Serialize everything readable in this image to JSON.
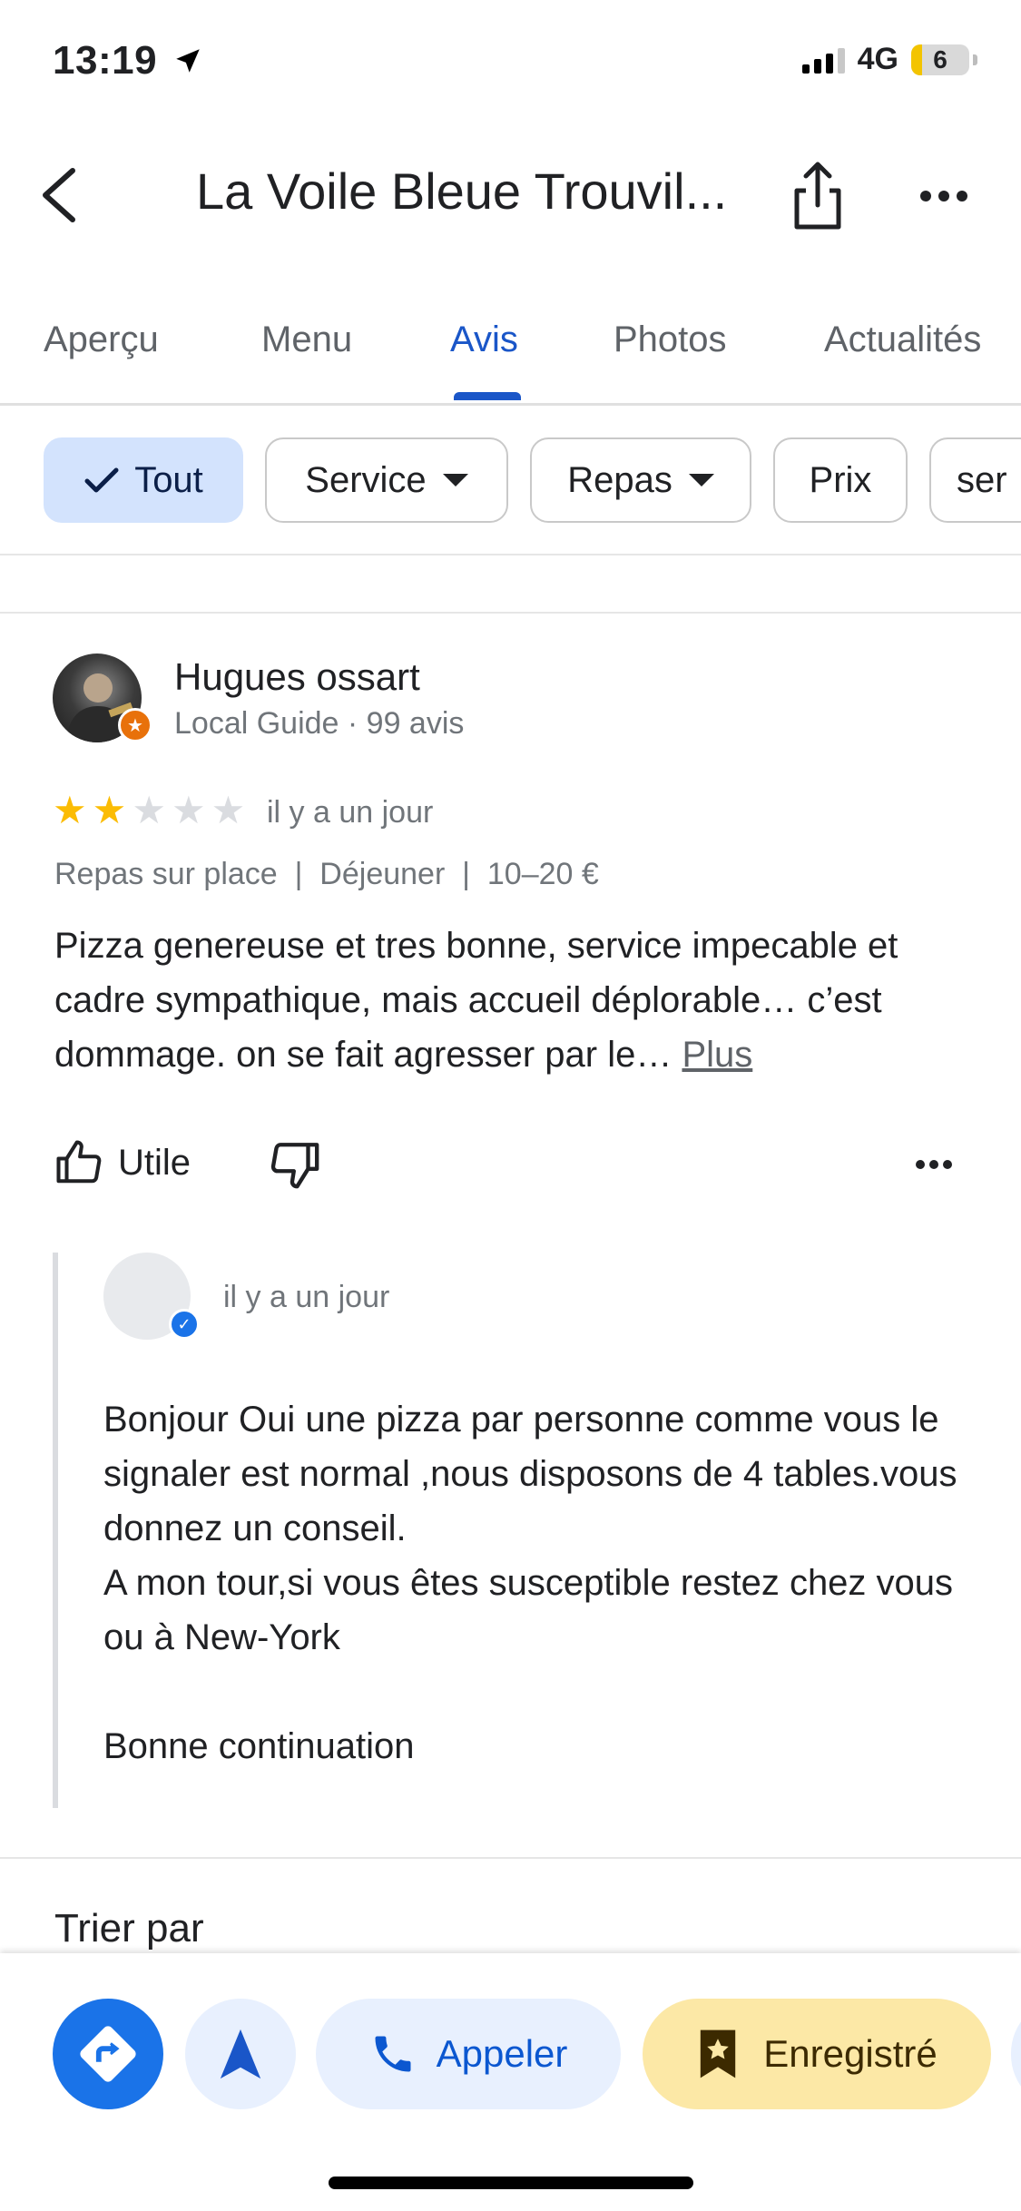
{
  "status_bar": {
    "time": "13:19",
    "network": "4G",
    "battery": "6"
  },
  "header": {
    "title": "La Voile Bleue Trouvil..."
  },
  "tabs": [
    {
      "label": "Aperçu",
      "active": false
    },
    {
      "label": "Menu",
      "active": false
    },
    {
      "label": "Avis",
      "active": true
    },
    {
      "label": "Photos",
      "active": false
    },
    {
      "label": "Actualités",
      "active": false
    }
  ],
  "filters": [
    {
      "label": "Tout",
      "selected": true
    },
    {
      "label": "Service",
      "dropdown": true
    },
    {
      "label": "Repas",
      "dropdown": true
    },
    {
      "label": "Prix"
    },
    {
      "label": "ser"
    }
  ],
  "review": {
    "author": "Hugues ossart",
    "meta": "Local Guide · 99 avis",
    "rating": 2,
    "rating_max": 5,
    "date": "il y a un jour",
    "visit_meta": "Repas sur place  |  Déjeuner  |  10–20 €",
    "text": "Pizza genereuse et tres bonne, service impecable et cadre sympathique, mais accueil déplorable… c’est dommage. on se fait agresser par le… ",
    "more_label": "Plus",
    "helpful_label": "Utile"
  },
  "owner_reply": {
    "date": "il y a un jour",
    "text": "Bonjour Oui une pizza par personne comme vous le signaler  est normal  ,nous disposons  de 4 tables.vous donnez un conseil.\nA mon tour,si vous êtes susceptible  restez chez vous ou à New-York\n\nBonne continuation"
  },
  "sort": {
    "title": "Trier par"
  },
  "actions": {
    "call_label": "Appeler",
    "saved_label": "Enregistré"
  },
  "colors": {
    "accent": "#1a56c8",
    "star": "#fbbc04",
    "saved_bg": "#fce8a6"
  }
}
